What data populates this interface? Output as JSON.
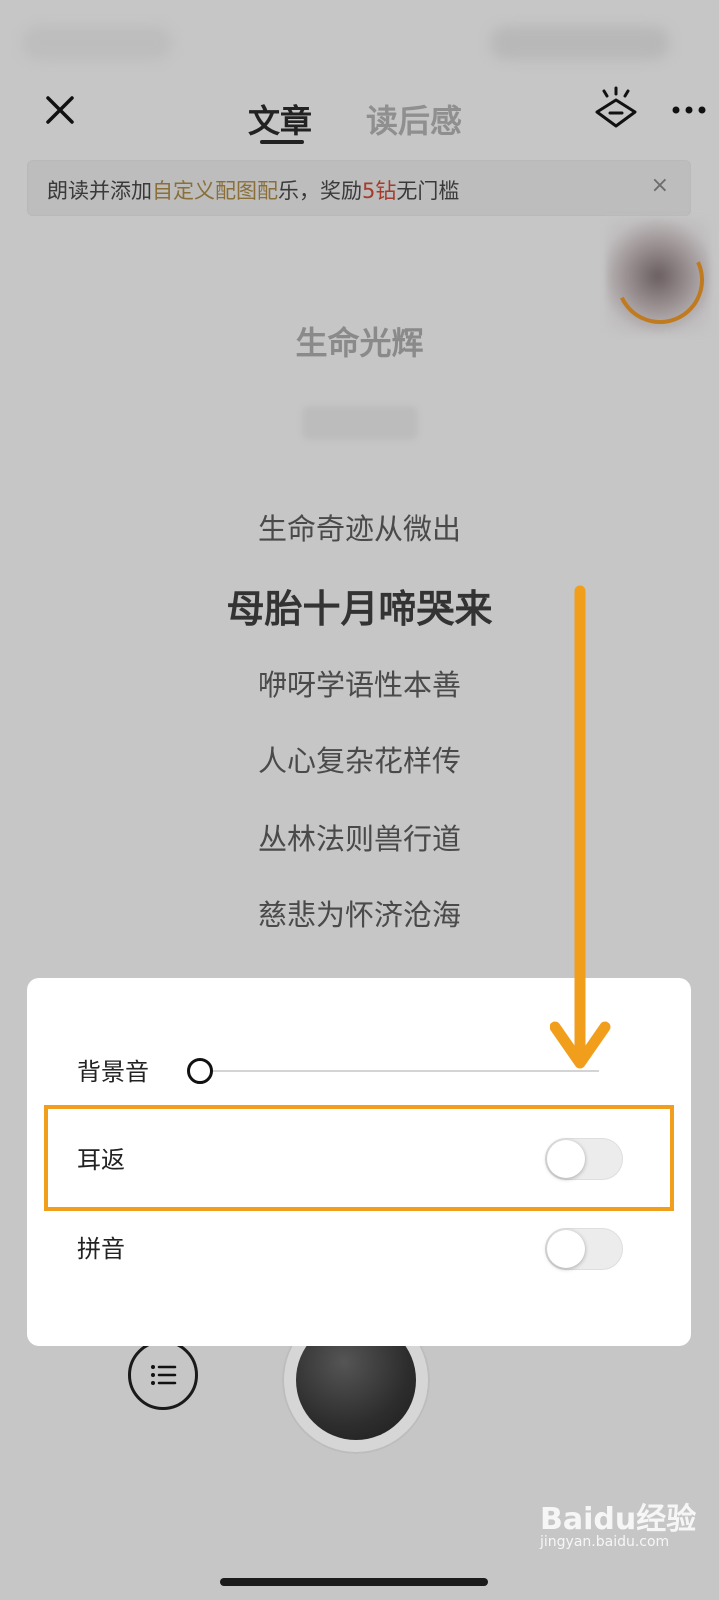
{
  "header": {
    "tabs": [
      {
        "label": "文章",
        "active": true
      },
      {
        "label": "读后感",
        "active": false
      }
    ],
    "close_icon": "close-icon",
    "eye_icon": "eye-mode-icon",
    "more_icon": "more-icon"
  },
  "banner": {
    "part1": "朗读并添加",
    "highlight": "自定义配图配",
    "part2": "乐，奖励",
    "reward": "5钻",
    "part3": "无门槛",
    "close": "×"
  },
  "article": {
    "title": "生命光辉",
    "lines": [
      "生命奇迹从微出",
      "母胎十月啼哭来",
      "咿呀学语性本善",
      "人心复杂花样传",
      "丛林法则兽行道",
      "慈悲为怀济沧海"
    ],
    "current_line_index": 1
  },
  "settings": {
    "background_sound": {
      "label": "背景音",
      "level": 0
    },
    "ear_return": {
      "label": "耳返",
      "on": false
    },
    "pinyin": {
      "label": "拼音",
      "on": false
    }
  },
  "colors": {
    "highlight_border": "#f19e1c",
    "arrow": "#f19e1c",
    "banner_highlight": "#8a6f38",
    "banner_reward": "#a53b2c"
  },
  "watermark": {
    "text": "Baidu经验",
    "sub": "jingyan.baidu.com"
  }
}
